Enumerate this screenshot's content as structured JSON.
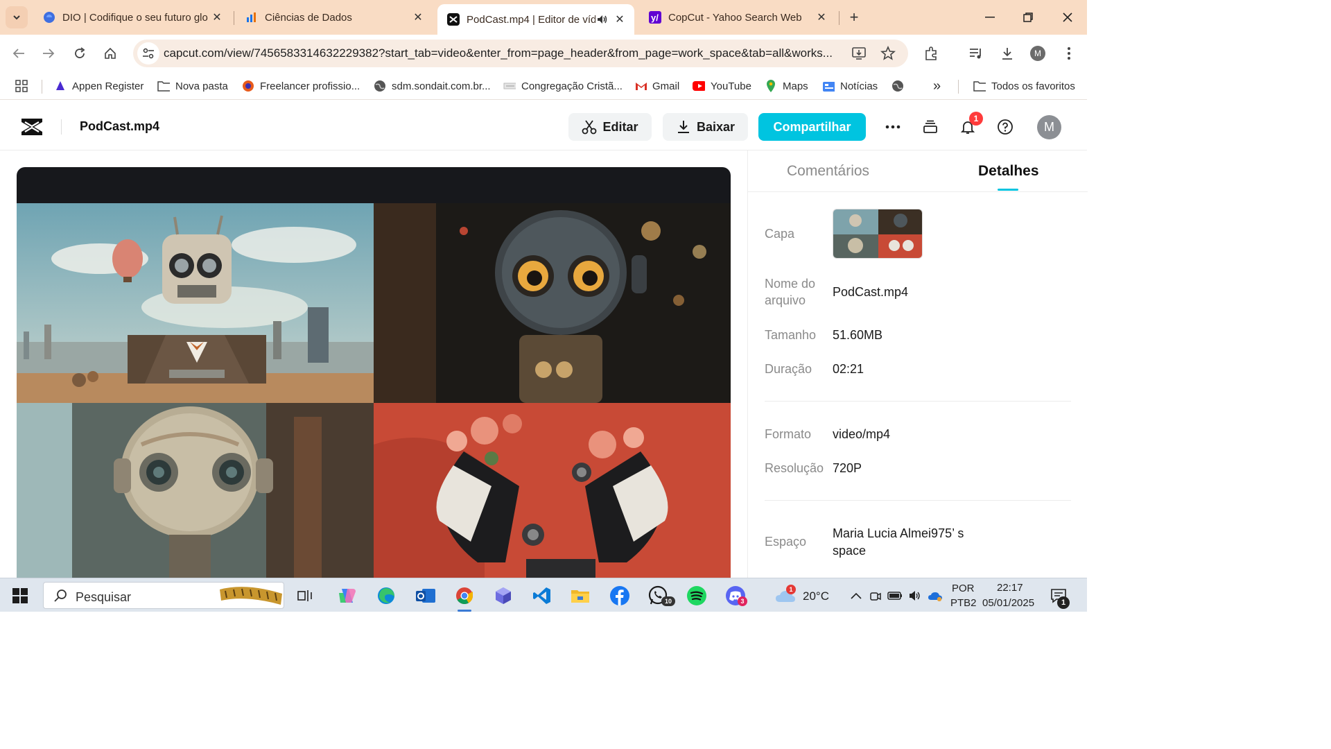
{
  "browser": {
    "tabs": [
      {
        "title": "DIO | Codifique o seu futuro glo",
        "favicon": "dio-icon"
      },
      {
        "title": "Ciências de Dados",
        "favicon": "chart-icon"
      },
      {
        "title": "PodCast.mp4 | Editor de víd",
        "favicon": "capcut-icon",
        "active": true
      },
      {
        "title": "CopCut - Yahoo Search Web",
        "favicon": "yahoo-icon"
      }
    ],
    "url": "capcut.com/view/7456583314632229382?start_tab=video&enter_from=page_header&from_page=work_space&tab=all&works...",
    "bookmarks": [
      {
        "label": "Appen Register",
        "icon": "appen-icon"
      },
      {
        "label": "Nova pasta",
        "icon": "folder-icon"
      },
      {
        "label": "Freelancer profissio...",
        "icon": "freelancer-icon"
      },
      {
        "label": "sdm.sondait.com.br...",
        "icon": "globe-icon"
      },
      {
        "label": "Congregação Cristã...",
        "icon": "ccb-icon"
      },
      {
        "label": "Gmail",
        "icon": "gmail-icon"
      },
      {
        "label": "YouTube",
        "icon": "youtube-icon"
      },
      {
        "label": "Maps",
        "icon": "maps-icon"
      },
      {
        "label": "Notícias",
        "icon": "news-icon"
      }
    ],
    "all_bookmarks": "Todos os favoritos",
    "more_bookmarks": "»"
  },
  "app": {
    "file_title": "PodCast.mp4",
    "edit_label": "Editar",
    "download_label": "Baixar",
    "share_label": "Compartilhar",
    "notification_count": "1",
    "avatar_letter": "M",
    "accent": "#00c4e0"
  },
  "panel": {
    "tabs": [
      "Comentários",
      "Detalhes"
    ],
    "active_tab": "Detalhes",
    "details": {
      "cover_label": "Capa",
      "filename_label": "Nome do arquivo",
      "filename": "PodCast.mp4",
      "size_label": "Tamanho",
      "size": "51.60MB",
      "duration_label": "Duração",
      "duration": "02:21",
      "format_label": "Formato",
      "format": "video/mp4",
      "resolution_label": "Resolução",
      "resolution": "720P",
      "space_label": "Espaço",
      "space": "Maria Lucia Almei975’ s space"
    }
  },
  "taskbar": {
    "search_placeholder": "Pesquisar",
    "weather": "20°C",
    "weather_badge": "1",
    "lang_top": "POR",
    "lang_bottom": "PTB2",
    "time": "22:17",
    "date": "05/01/2025",
    "whatsapp_badge": "10",
    "discord_badge": "3",
    "notif_badge": "1"
  }
}
